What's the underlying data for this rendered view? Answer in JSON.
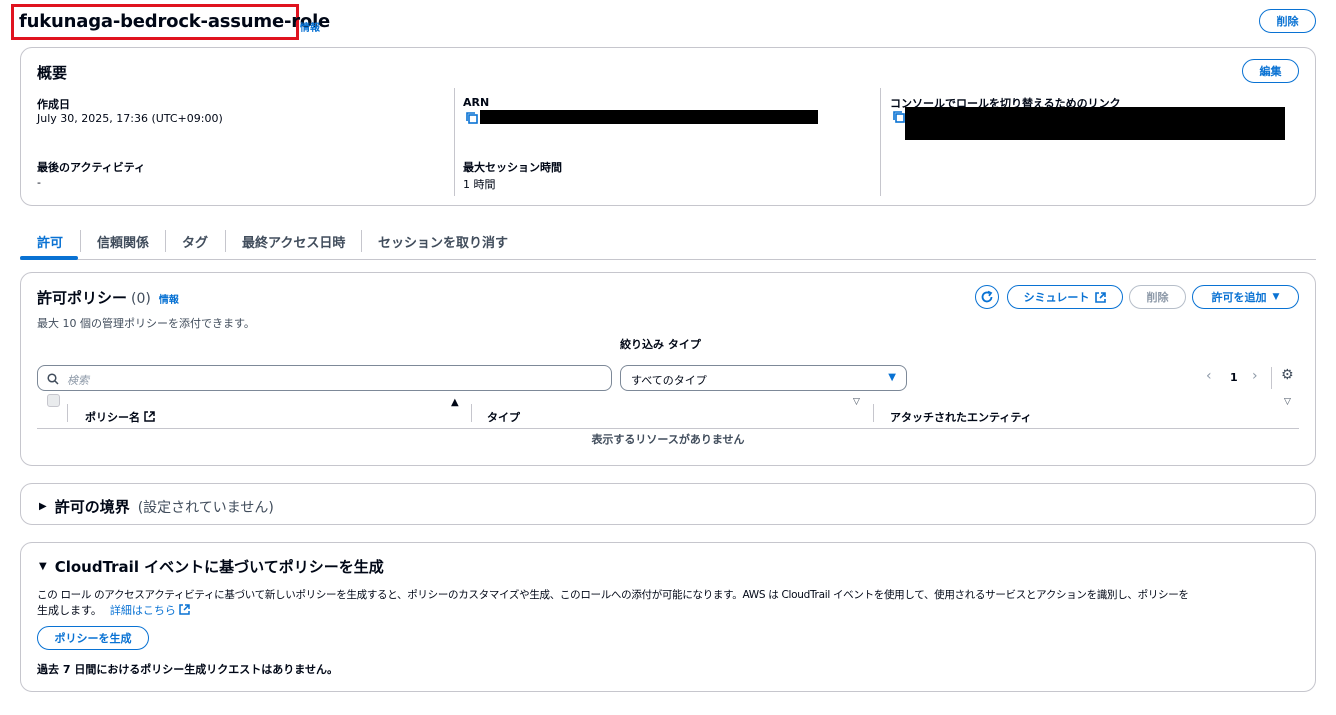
{
  "header": {
    "title": "fukunaga-bedrock-assume-role",
    "info": "情報",
    "delete_label": "削除"
  },
  "summary": {
    "heading": "概要",
    "edit_label": "編集",
    "created_label": "作成日",
    "created_value": "July 30, 2025, 17:36 (UTC+09:00)",
    "arn_label": "ARN",
    "switch_link_label": "コンソールでロールを切り替えるためのリンク",
    "last_activity_label": "最後のアクティビティ",
    "last_activity_value": "-",
    "max_session_label": "最大セッション時間",
    "max_session_value": "1 時間"
  },
  "tabs": [
    "許可",
    "信頼関係",
    "タグ",
    "最終アクセス日時",
    "セッションを取り消す"
  ],
  "policies": {
    "heading": "許可ポリシー",
    "count": "(0)",
    "info": "情報",
    "description": "最大 10 個の管理ポリシーを添付できます。",
    "simulate_label": "シミュレート",
    "delete_label": "削除",
    "add_label": "許可を追加",
    "search_placeholder": "検索",
    "filter_label": "絞り込み タイプ",
    "filter_value": "すべてのタイプ",
    "page": "1",
    "columns": [
      "ポリシー名",
      "タイプ",
      "アタッチされたエンティティ"
    ],
    "empty": "表示するリソースがありません"
  },
  "boundary": {
    "heading": "許可の境界",
    "status": "(設定されていません)"
  },
  "cloudtrail": {
    "heading": "CloudTrail イベントに基づいてポリシーを生成",
    "description": "この ロール のアクセスアクティビティに基づいて新しいポリシーを生成すると、ポリシーのカスタマイズや生成、このロールへの添付が可能になります。AWS は CloudTrail イベントを使用して、使用されるサービスとアクションを識別し、ポリシーを",
    "description2": "生成します。",
    "details_link": "詳細はこちら",
    "generate_label": "ポリシーを生成",
    "no_requests": "過去 7 日間におけるポリシー生成リクエストはありません。"
  },
  "colors": {
    "accent": "#0972d3",
    "highlight_box": "#e0131f",
    "border": "#c6c6cd"
  }
}
